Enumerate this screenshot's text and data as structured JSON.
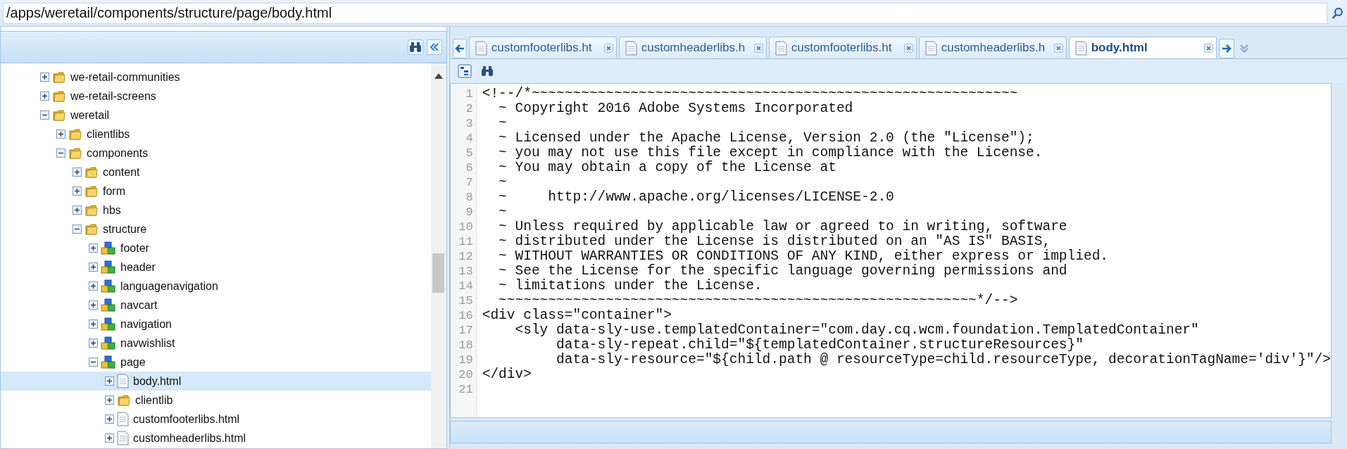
{
  "path_field": {
    "value": "/apps/weretail/components/structure/page/body.html"
  },
  "tree": [
    {
      "label": "we-retail-communities",
      "kind": "folder",
      "expanded": false,
      "selected": false
    },
    {
      "label": "we-retail-screens",
      "kind": "folder",
      "expanded": false,
      "selected": false
    },
    {
      "label": "weretail",
      "kind": "folder",
      "expanded": true,
      "selected": false,
      "children": [
        {
          "label": "clientlibs",
          "kind": "folder",
          "expanded": false,
          "selected": false
        },
        {
          "label": "components",
          "kind": "folder",
          "expanded": true,
          "selected": false,
          "children": [
            {
              "label": "content",
              "kind": "folder",
              "expanded": false,
              "selected": false
            },
            {
              "label": "form",
              "kind": "folder",
              "expanded": false,
              "selected": false
            },
            {
              "label": "hbs",
              "kind": "folder",
              "expanded": false,
              "selected": false
            },
            {
              "label": "structure",
              "kind": "folder",
              "expanded": true,
              "selected": false,
              "children": [
                {
                  "label": "footer",
                  "kind": "component",
                  "expanded": false,
                  "selected": false
                },
                {
                  "label": "header",
                  "kind": "component",
                  "expanded": false,
                  "selected": false
                },
                {
                  "label": "languagenavigation",
                  "kind": "component",
                  "expanded": false,
                  "selected": false
                },
                {
                  "label": "navcart",
                  "kind": "component",
                  "expanded": false,
                  "selected": false
                },
                {
                  "label": "navigation",
                  "kind": "component",
                  "expanded": false,
                  "selected": false
                },
                {
                  "label": "navwishlist",
                  "kind": "component",
                  "expanded": false,
                  "selected": false
                },
                {
                  "label": "page",
                  "kind": "component",
                  "expanded": true,
                  "selected": false,
                  "children": [
                    {
                      "label": "body.html",
                      "kind": "file",
                      "expanded": false,
                      "selected": true
                    },
                    {
                      "label": "clientlib",
                      "kind": "folder",
                      "expanded": false,
                      "selected": false
                    },
                    {
                      "label": "customfooterlibs.html",
                      "kind": "file",
                      "expanded": false,
                      "selected": false
                    },
                    {
                      "label": "customheaderlibs.html",
                      "kind": "file",
                      "expanded": false,
                      "selected": false
                    }
                  ]
                }
              ]
            }
          ]
        }
      ]
    }
  ],
  "tabs": [
    {
      "label": "customfooterlibs.ht",
      "selected": false
    },
    {
      "label": "customheaderlibs.h",
      "selected": false
    },
    {
      "label": "customfooterlibs.ht",
      "selected": false
    },
    {
      "label": "customheaderlibs.h",
      "selected": false
    },
    {
      "label": "body.html",
      "selected": true
    }
  ],
  "code_lines": [
    {
      "number": "1",
      "text": "<!--/*~~~~~~~~~~~~~~~~~~~~~~~~~~~~~~~~~~~~~~~~~~~~~~~~~~~~~~~~~~~"
    },
    {
      "number": "2",
      "text": "  ~ Copyright 2016 Adobe Systems Incorporated"
    },
    {
      "number": "3",
      "text": "  ~"
    },
    {
      "number": "4",
      "text": "  ~ Licensed under the Apache License, Version 2.0 (the \"License\");"
    },
    {
      "number": "5",
      "text": "  ~ you may not use this file except in compliance with the License."
    },
    {
      "number": "6",
      "text": "  ~ You may obtain a copy of the License at"
    },
    {
      "number": "7",
      "text": "  ~"
    },
    {
      "number": "8",
      "text": "  ~     http://www.apache.org/licenses/LICENSE-2.0"
    },
    {
      "number": "9",
      "text": "  ~"
    },
    {
      "number": "10",
      "text": "  ~ Unless required by applicable law or agreed to in writing, software"
    },
    {
      "number": "11",
      "text": "  ~ distributed under the License is distributed on an \"AS IS\" BASIS,"
    },
    {
      "number": "12",
      "text": "  ~ WITHOUT WARRANTIES OR CONDITIONS OF ANY KIND, either express or implied."
    },
    {
      "number": "13",
      "text": "  ~ See the License for the specific language governing permissions and"
    },
    {
      "number": "14",
      "text": "  ~ limitations under the License."
    },
    {
      "number": "15",
      "text": "  ~~~~~~~~~~~~~~~~~~~~~~~~~~~~~~~~~~~~~~~~~~~~~~~~~~~~~~~~~~*/-->"
    },
    {
      "number": "16",
      "text": "<div class=\"container\">"
    },
    {
      "number": "17",
      "text": "    <sly data-sly-use.templatedContainer=\"com.day.cq.wcm.foundation.TemplatedContainer\""
    },
    {
      "number": "18",
      "text": "         data-sly-repeat.child=\"${templatedContainer.structureResources}\""
    },
    {
      "number": "19",
      "text": "         data-sly-resource=\"${child.path @ resourceType=child.resourceType, decorationTagName='div'}\"/>"
    },
    {
      "number": "20",
      "text": "</div>"
    },
    {
      "number": "21"
    }
  ]
}
